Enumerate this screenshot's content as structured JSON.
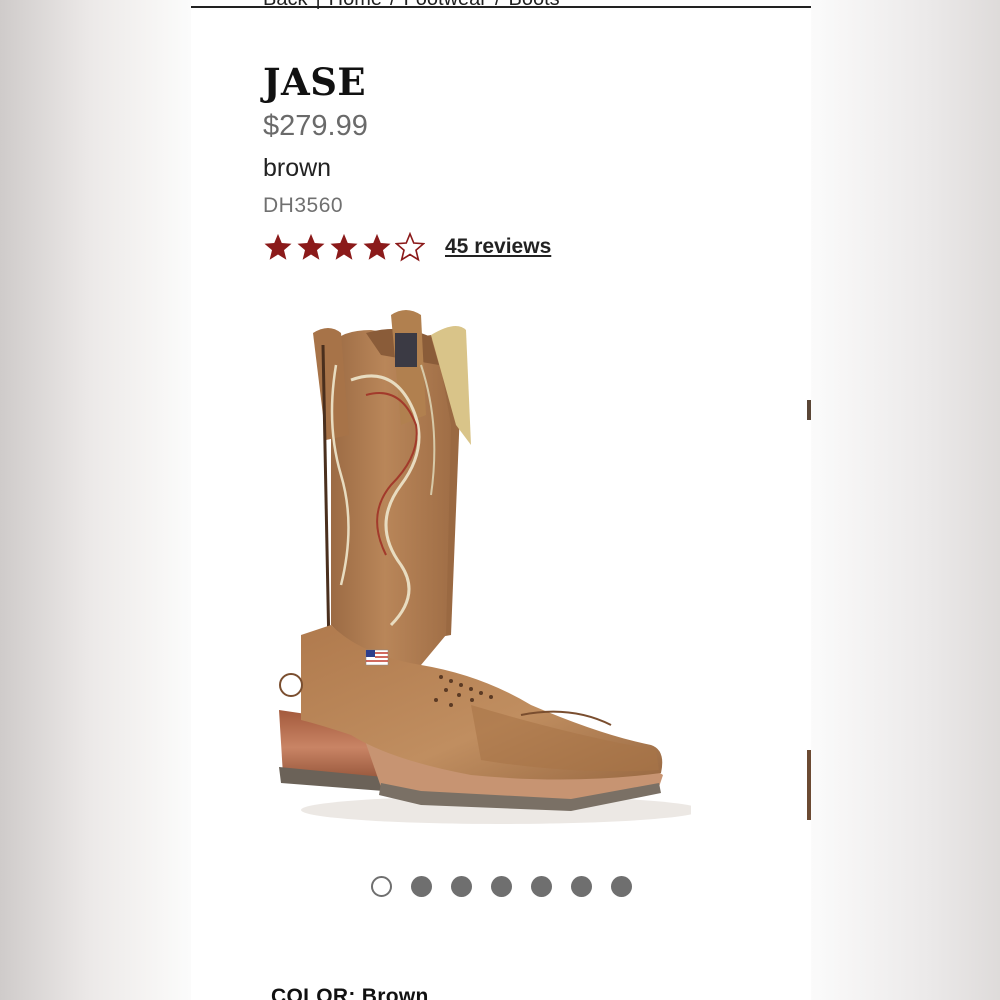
{
  "breadcrumb": [
    "Back",
    "Home",
    "Footwear",
    "Boots"
  ],
  "product": {
    "name": "JASE",
    "price": "$279.99",
    "color": "brown",
    "sku": "DH3560",
    "rating": {
      "value": 4,
      "max": 5,
      "reviews_label": "45 reviews"
    },
    "image_alt": "Brown leather western boot"
  },
  "carousel": {
    "count": 7,
    "active_index": 0
  },
  "color_label": "COLOR: Brown",
  "icons": {
    "star_filled": "star-filled-icon",
    "star_empty": "star-outline-icon"
  },
  "colors": {
    "star": "#8b1a1a",
    "text": "#111111",
    "price": "#6a6a6a",
    "dot": "#6f6f6f",
    "leather": "#b07a4d"
  }
}
